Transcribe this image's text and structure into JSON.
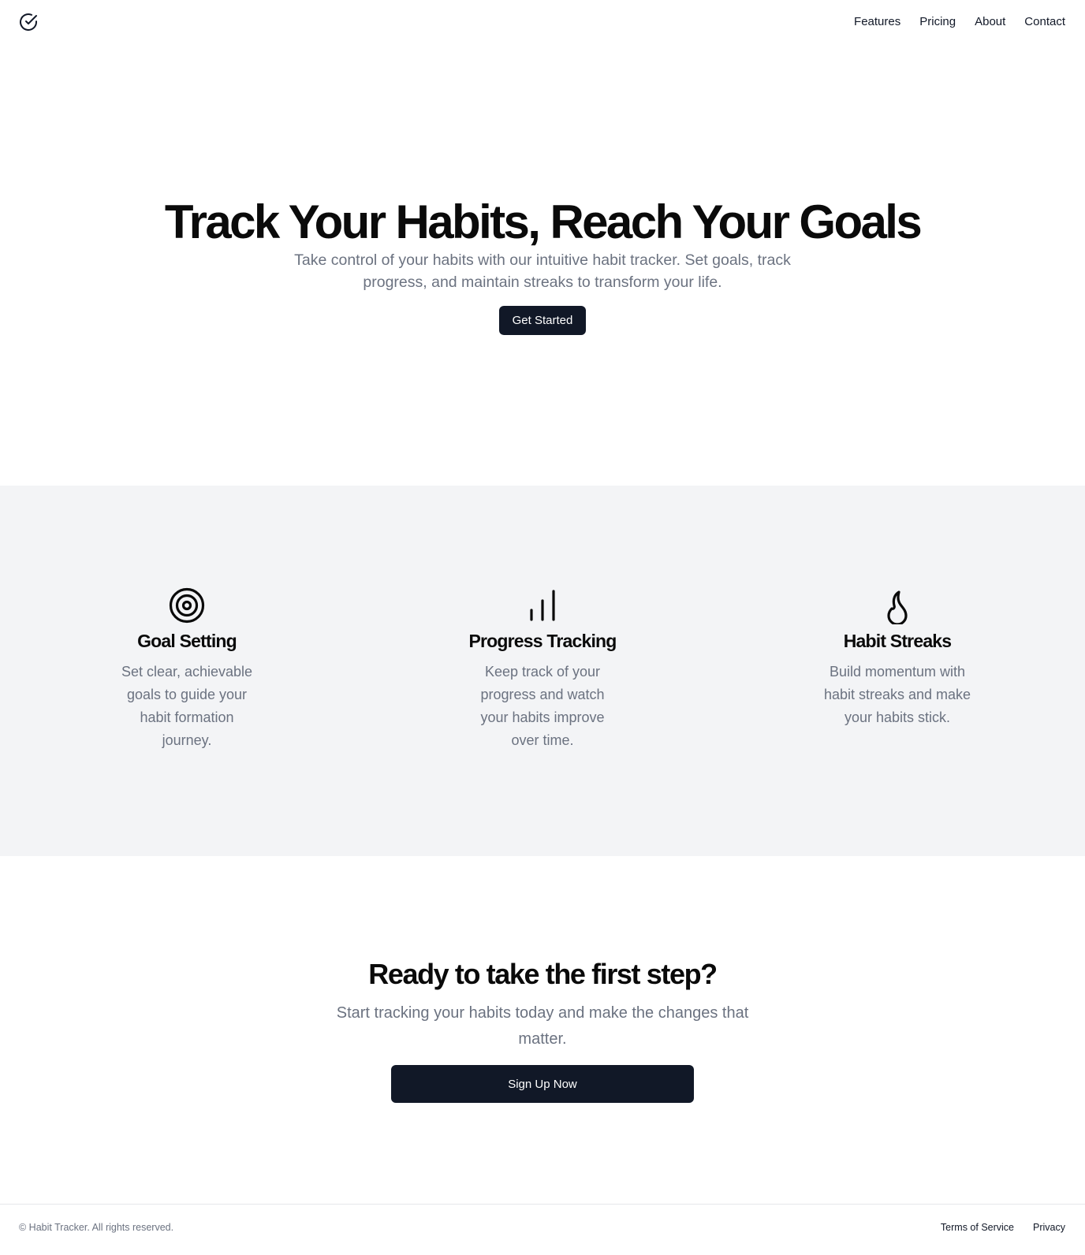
{
  "header": {
    "logo_icon": "check-circle-icon",
    "nav": [
      {
        "label": "Features"
      },
      {
        "label": "Pricing"
      },
      {
        "label": "About"
      },
      {
        "label": "Contact"
      }
    ]
  },
  "hero": {
    "title": "Track Your Habits, Reach Your Goals",
    "subtitle": "Take control of your habits with our intuitive habit tracker. Set goals, track progress, and maintain streaks to transform your life.",
    "button_label": "Get Started"
  },
  "features": [
    {
      "icon": "target-icon",
      "title": "Goal Setting",
      "description": "Set clear, achievable goals to guide your habit formation journey."
    },
    {
      "icon": "bar-chart-icon",
      "title": "Progress Tracking",
      "description": "Keep track of your progress and watch your habits improve over time."
    },
    {
      "icon": "flame-icon",
      "title": "Habit Streaks",
      "description": "Build momentum with habit streaks and make your habits stick."
    }
  ],
  "cta": {
    "title": "Ready to take the first step?",
    "subtitle": "Start tracking your habits today and make the changes that matter.",
    "button_label": "Sign Up Now"
  },
  "footer": {
    "copyright": "© Habit Tracker. All rights reserved.",
    "links": [
      {
        "label": "Terms of Service"
      },
      {
        "label": "Privacy"
      }
    ]
  },
  "colors": {
    "primary_dark": "#111827",
    "muted_text": "#6b7280",
    "section_bg": "#f3f4f6",
    "border": "#e5e7eb"
  }
}
